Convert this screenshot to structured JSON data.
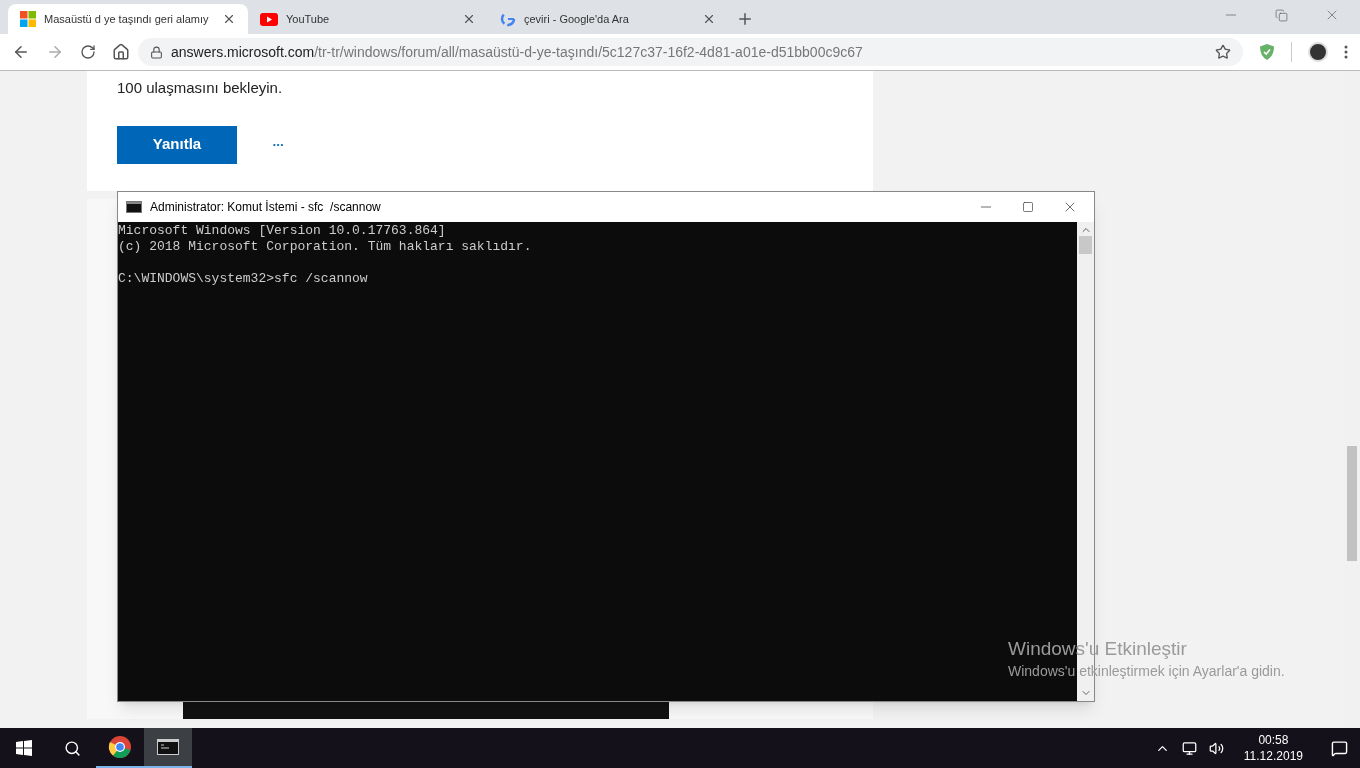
{
  "tabs": [
    {
      "title": "Masaüstü d ye taşındı geri alamıy",
      "kind": "windows",
      "selected": true
    },
    {
      "title": "YouTube",
      "kind": "youtube",
      "selected": false
    },
    {
      "title": "çeviri - Google'da Ara",
      "kind": "google",
      "selected": false
    }
  ],
  "address": {
    "domain": "answers.microsoft.com",
    "path": "/tr-tr/windows/forum/all/masaüstü-d-ye-taşındı/5c127c37-16f2-4d81-a01e-d51bb00c9c67"
  },
  "page": {
    "paragraph": "100 ulaşmasını bekleyin.",
    "reply_button": "Yanıtla",
    "more": "•••"
  },
  "console": {
    "title": "Administrator: Komut İstemi - sfc  /scannow",
    "lines": [
      "Microsoft Windows [Version 10.0.17763.864]",
      "(c) 2018 Microsoft Corporation. Tüm hakları saklıdır.",
      "C:\\WINDOWS\\system32>sfc /scannow"
    ]
  },
  "activation": {
    "title": "Windows'u Etkinleştir",
    "text": "Windows'u etkinleştirmek için Ayarlar'a gidin."
  },
  "taskbar": {
    "apps": [
      {
        "kind": "chrome",
        "active": false
      },
      {
        "kind": "console",
        "active": true
      }
    ],
    "time": "00:58",
    "date": "11.12.2019"
  }
}
